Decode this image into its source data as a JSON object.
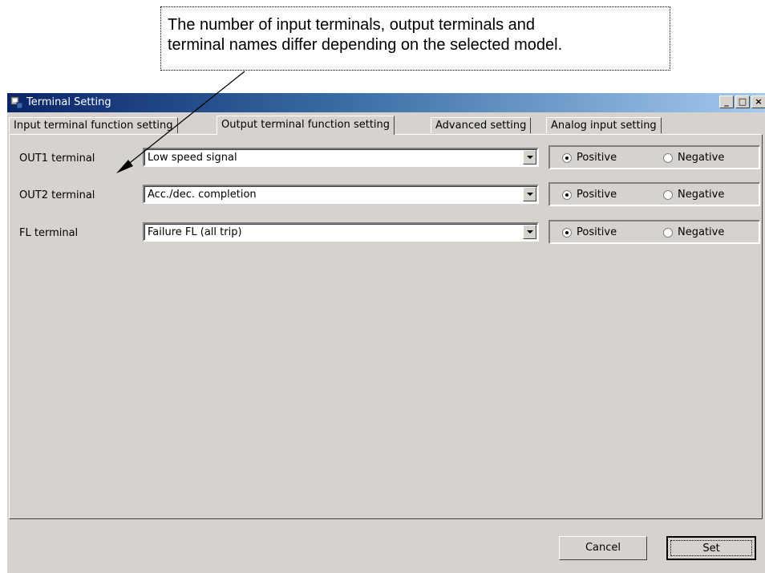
{
  "callout": {
    "line1": "The number of input terminals, output terminals and",
    "line2": "terminal names differ depending on the selected model."
  },
  "window": {
    "title": "Terminal Setting",
    "controls": {
      "minimize": "_",
      "maximize": "□",
      "close": "×"
    }
  },
  "tabs": [
    {
      "label": "Input terminal function setting",
      "active": false
    },
    {
      "label": "Output terminal function setting",
      "active": true
    },
    {
      "label": "Advanced setting",
      "active": false
    },
    {
      "label": "Analog input setting",
      "active": false
    }
  ],
  "rows": [
    {
      "label": "OUT1 terminal",
      "value": "Low speed signal",
      "positive": "Positive",
      "negative": "Negative",
      "selected": "Positive"
    },
    {
      "label": "OUT2 terminal",
      "value": "Acc./dec. completion",
      "positive": "Positive",
      "negative": "Negative",
      "selected": "Positive"
    },
    {
      "label": "FL terminal",
      "value": "Failure FL (all trip)",
      "positive": "Positive",
      "negative": "Negative",
      "selected": "Positive"
    }
  ],
  "buttons": {
    "cancel": "Cancel",
    "set": "Set"
  }
}
